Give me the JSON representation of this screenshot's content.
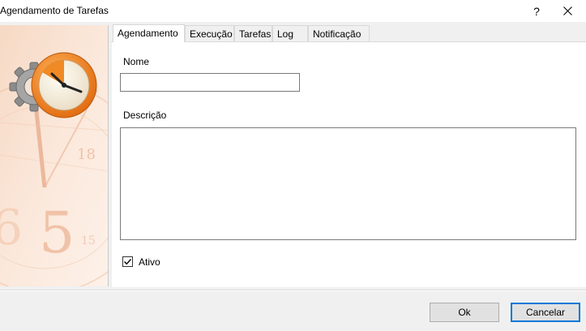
{
  "window": {
    "title": "Agendamento de Tarefas",
    "help_label": "?"
  },
  "tabs": [
    {
      "label": "Agendamento",
      "active": true
    },
    {
      "label": "Execução",
      "active": false
    },
    {
      "label": "Tarefas",
      "active": false
    },
    {
      "label": "Log",
      "active": false
    },
    {
      "label": "Notificação",
      "active": false
    }
  ],
  "form": {
    "name_label": "Nome",
    "name_value": "",
    "description_label": "Descrição",
    "description_value": "",
    "active_label": "Ativo",
    "active_checked": true
  },
  "buttons": {
    "ok_label": "Ok",
    "cancel_label": "Cancelar"
  },
  "colors": {
    "accent": "#0078d7",
    "clock_orange": "#f08a24",
    "panel_peach": "#fbe6d8"
  }
}
